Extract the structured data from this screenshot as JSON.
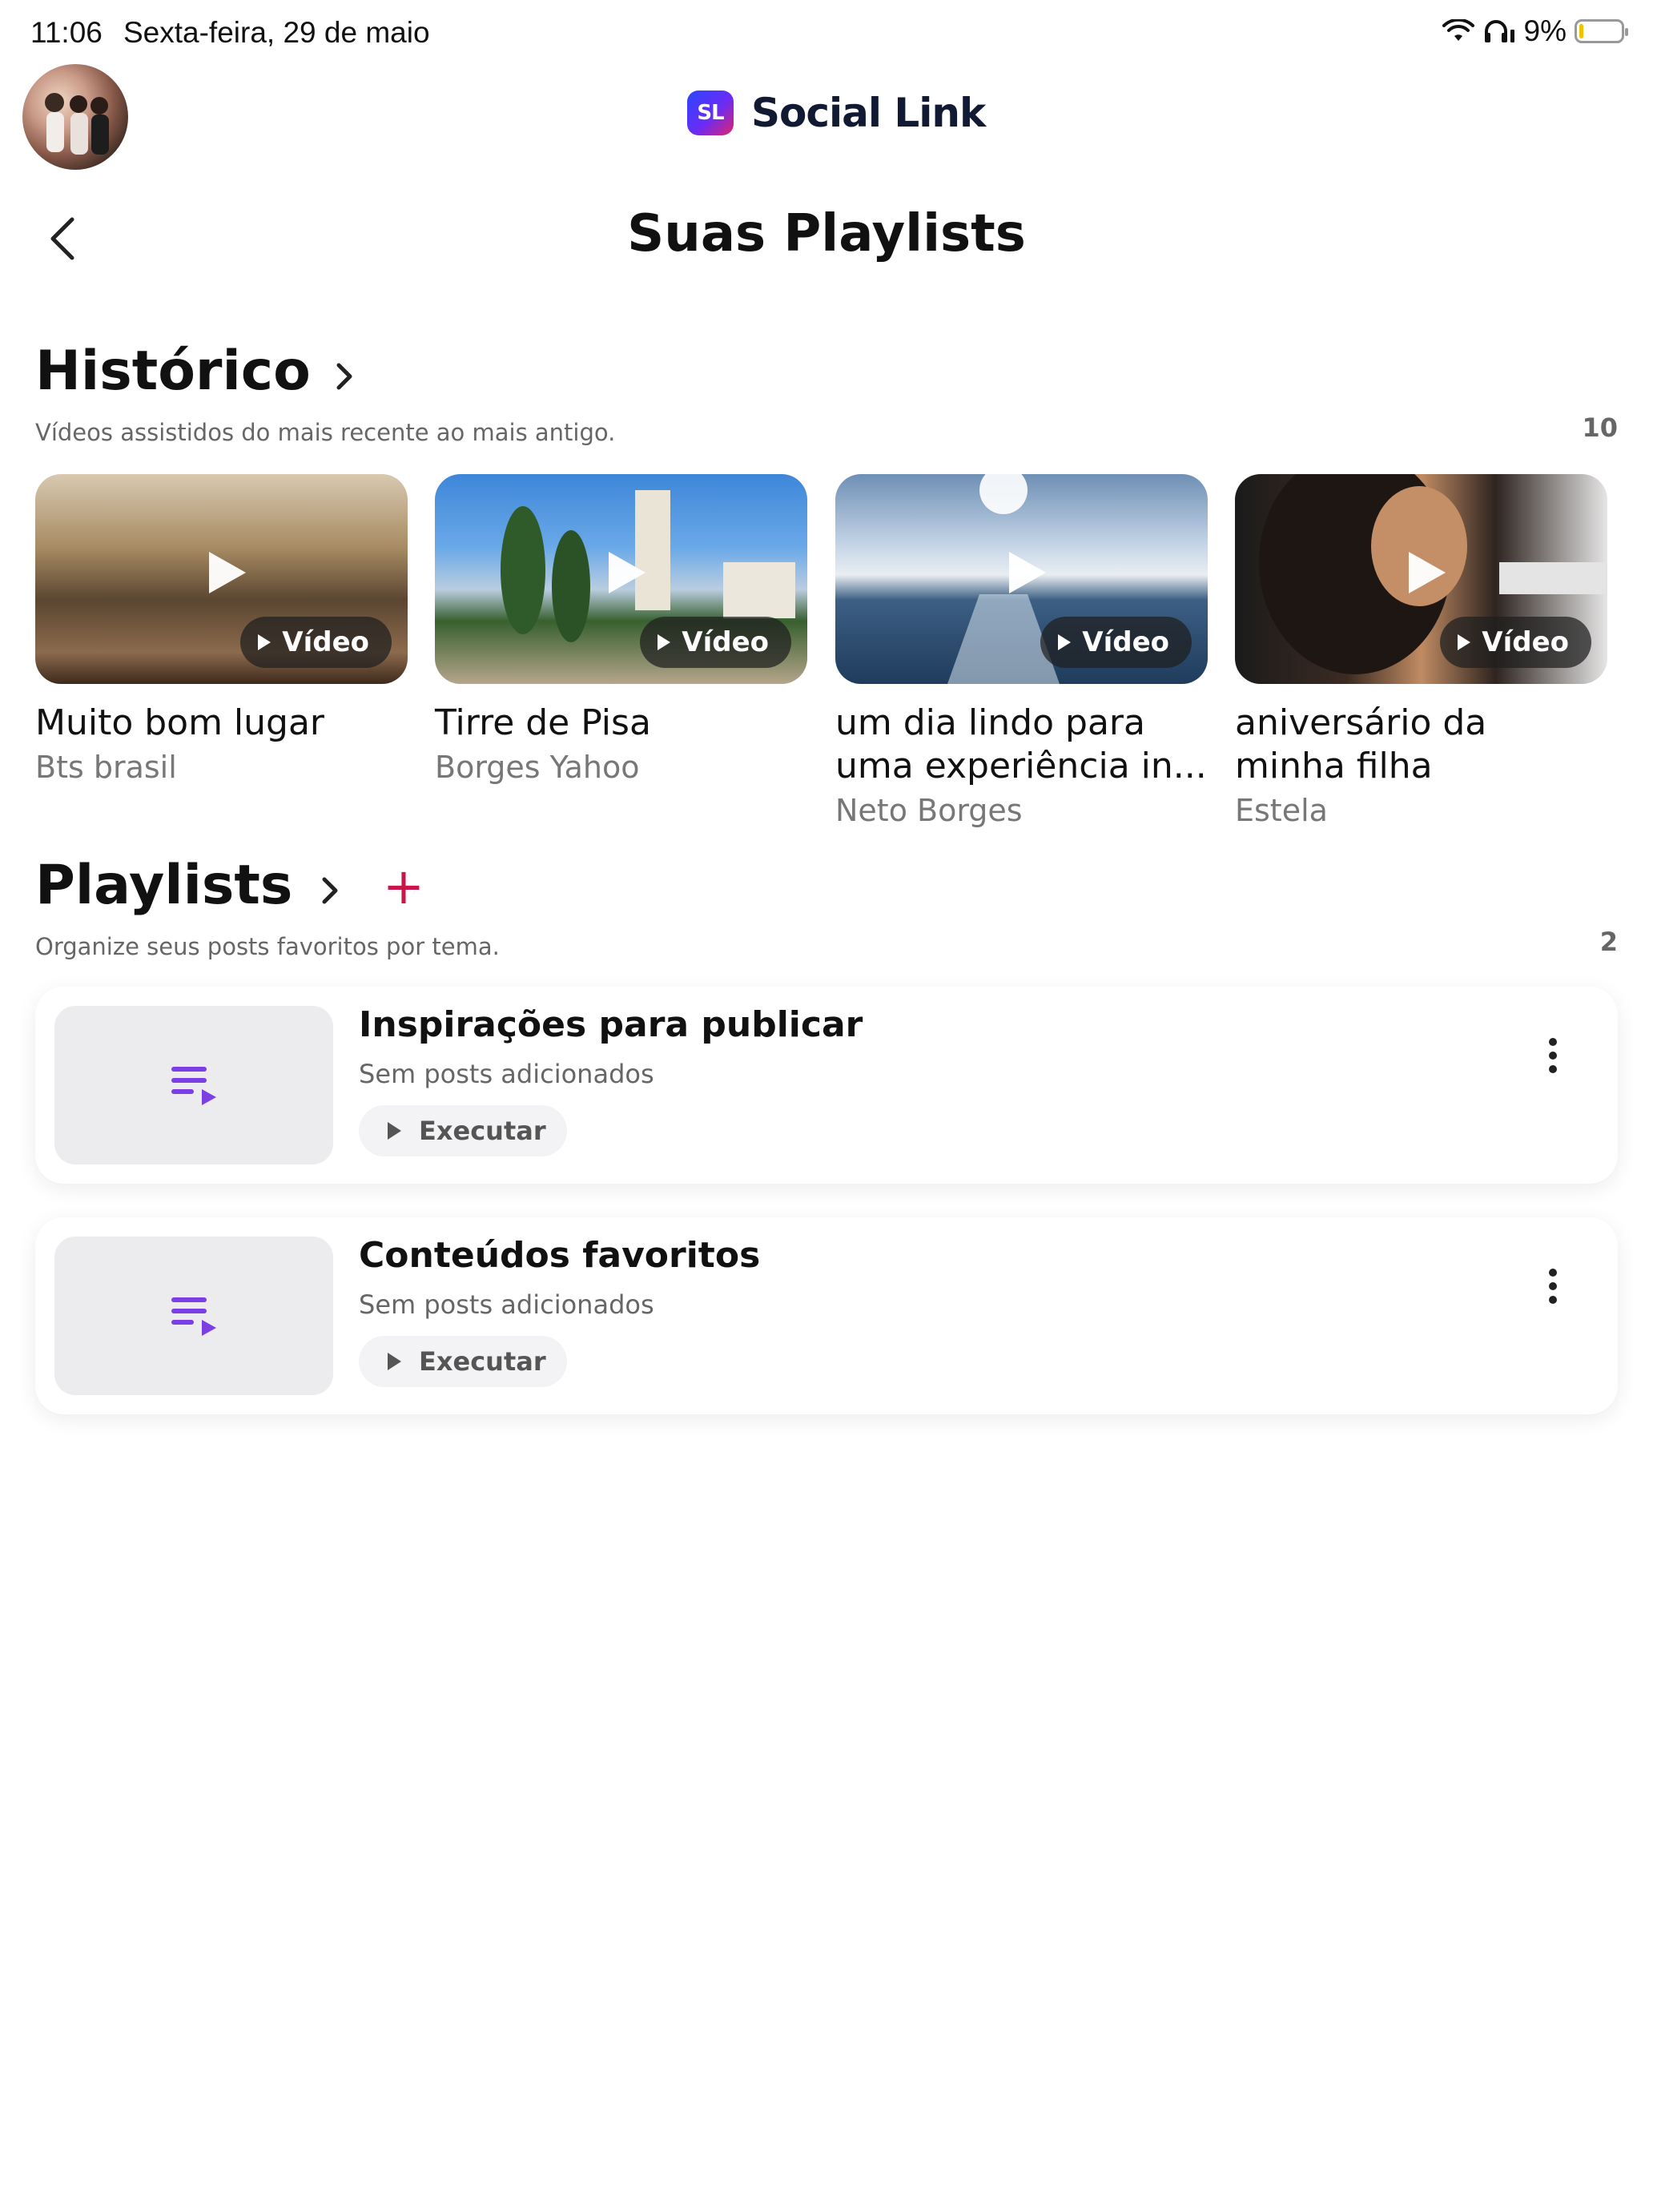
{
  "status": {
    "time": "11:06",
    "date": "Sexta-feira, 29 de maio",
    "battery": "9%",
    "battery_level": 0.09
  },
  "header": {
    "logo_text": "SL",
    "brand": "Social Link",
    "title": "Suas Playlists"
  },
  "history": {
    "title": "Histórico",
    "subtitle": "Vídeos assistidos do mais recente ao mais antigo.",
    "count": "10",
    "items": [
      {
        "title": "Muito bom lugar",
        "author": "Bts brasil",
        "badge": "Vídeo"
      },
      {
        "title": "Tirre de Pisa",
        "author": "Borges Yahoo",
        "badge": "Vídeo"
      },
      {
        "title": "um dia lindo para uma experiência in...",
        "author": "Neto Borges",
        "badge": "Vídeo"
      },
      {
        "title": "aniversário da minha filha",
        "author": "Estela",
        "badge": "Vídeo"
      }
    ]
  },
  "playlists": {
    "title": "Playlists",
    "add_label": "+",
    "subtitle": "Organize seus posts favoritos por tema.",
    "count": "2",
    "items": [
      {
        "name": "Inspirações para publicar",
        "posts": "Sem posts adicionados",
        "action": "Executar"
      },
      {
        "name": "Conteúdos favoritos",
        "posts": "Sem posts adicionados",
        "action": "Executar"
      }
    ]
  },
  "colors": {
    "accent_purple": "#7b3fe4",
    "add_red": "#c8154a"
  },
  "icons": {
    "wifi": "wifi-icon",
    "headphones": "headphones-icon",
    "back": "chevron-left-icon",
    "section_arrow": "chevron-right-icon",
    "playlist": "playlist-icon",
    "more": "more-vertical-icon",
    "play": "play-icon"
  }
}
